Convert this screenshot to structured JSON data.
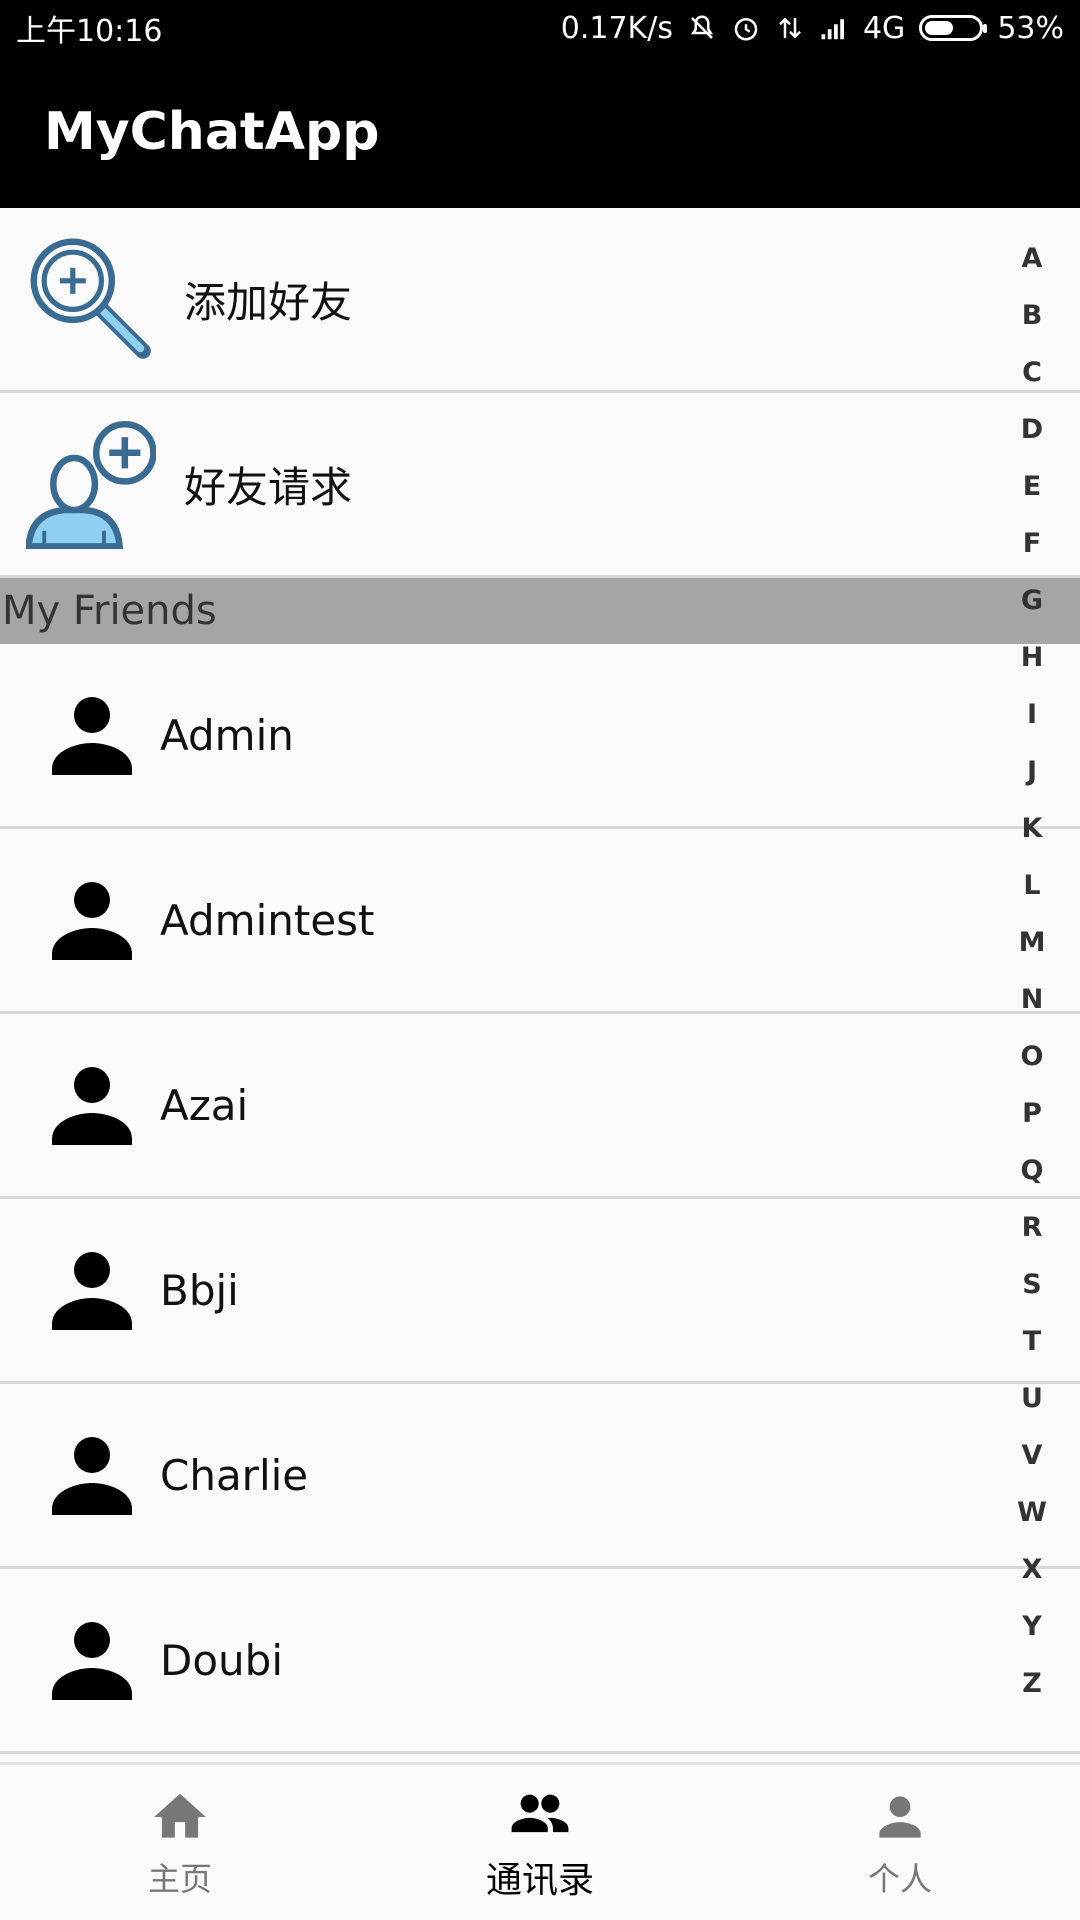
{
  "status_bar": {
    "time": "上午10:16",
    "net_speed": "0.17K/s",
    "network": "4G",
    "battery": "53%",
    "battery_level": 0.53,
    "icons": [
      "mute-bell-icon",
      "alarm-icon",
      "data-transfer-icon",
      "signal-icon",
      "battery-icon"
    ]
  },
  "app_bar": {
    "title": "MyChatApp"
  },
  "actions": [
    {
      "label": "添加好友",
      "icon": "add-friend-search-icon"
    },
    {
      "label": "好友请求",
      "icon": "friend-request-icon"
    }
  ],
  "section": {
    "title": "My Friends"
  },
  "friends": [
    {
      "name": "Admin"
    },
    {
      "name": "Admintest"
    },
    {
      "name": "Azai"
    },
    {
      "name": "Bbji"
    },
    {
      "name": "Charlie"
    },
    {
      "name": "Doubi"
    }
  ],
  "alphabet": [
    "A",
    "B",
    "C",
    "D",
    "E",
    "F",
    "G",
    "H",
    "I",
    "J",
    "K",
    "L",
    "M",
    "N",
    "O",
    "P",
    "Q",
    "R",
    "S",
    "T",
    "U",
    "V",
    "W",
    "X",
    "Y",
    "Z"
  ],
  "bottom_nav": [
    {
      "label": "主页",
      "icon": "home-icon",
      "active": false
    },
    {
      "label": "通讯录",
      "icon": "contacts-icon",
      "active": true
    },
    {
      "label": "个人",
      "icon": "person-icon",
      "active": false
    }
  ],
  "colors": {
    "app_bar": "#000000",
    "section_header": "#a5a5a5",
    "icon_blue": "#3a6b92",
    "icon_light_blue": "#8fd0f0",
    "nav_inactive": "#777777"
  }
}
